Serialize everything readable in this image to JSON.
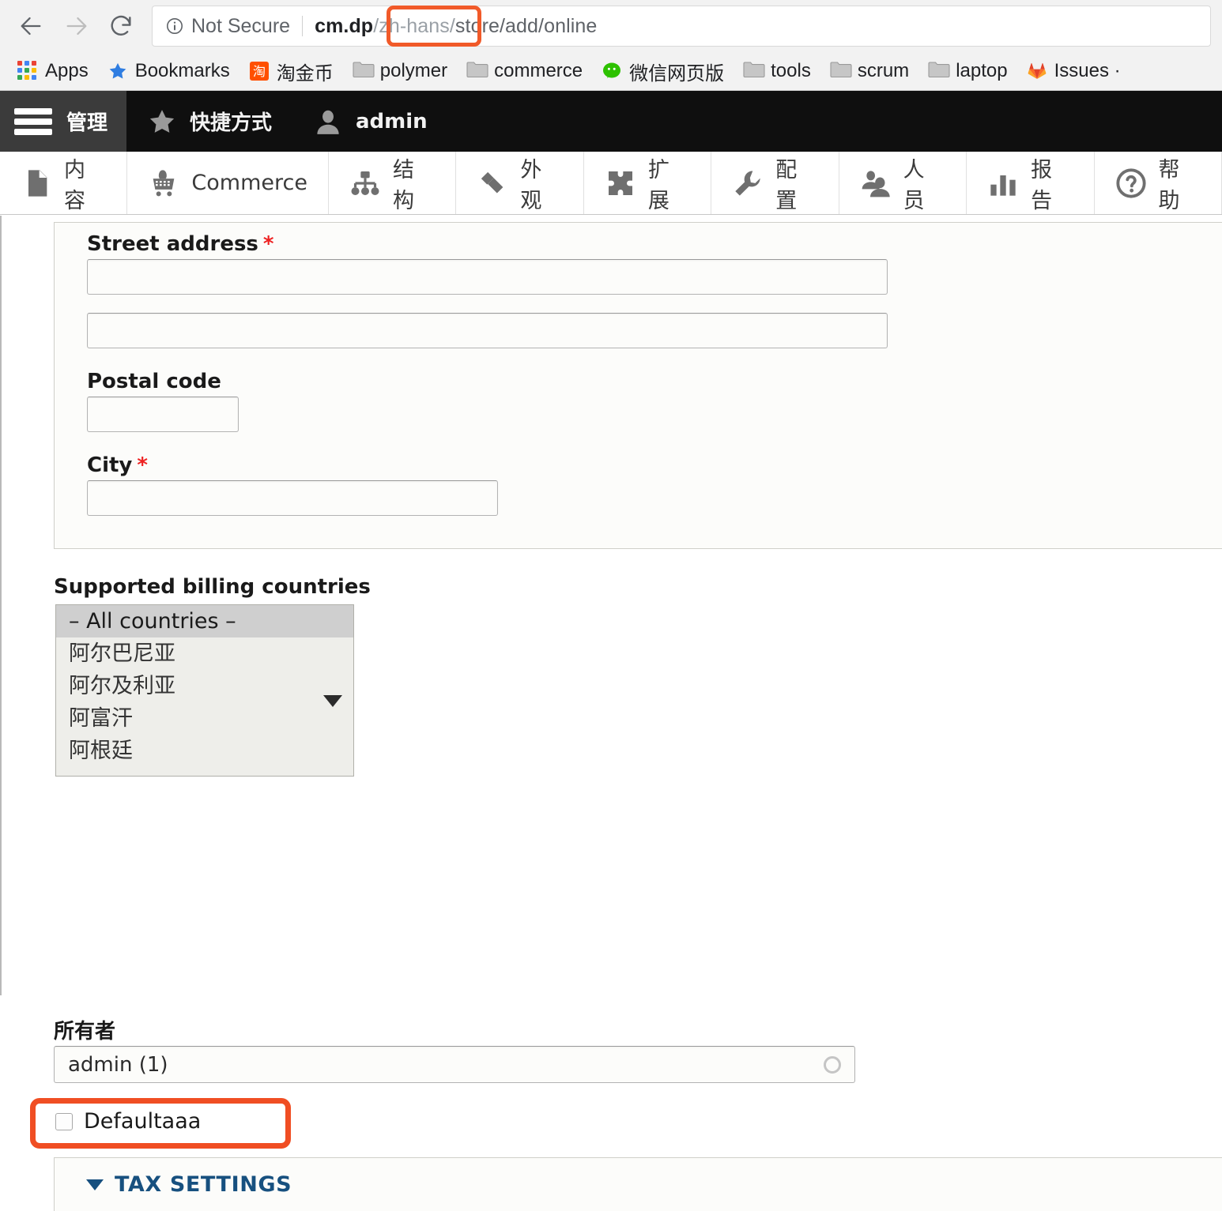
{
  "browser": {
    "nav": {
      "back_icon": "arrow-left-icon",
      "forward_icon": "arrow-right-icon",
      "reload_icon": "reload-icon"
    },
    "address_bar": {
      "security_icon": "info-circle-icon",
      "security_label": "Not Secure",
      "url_prefix": "cm.dp",
      "url_highlight": "/zh-hans/",
      "url_suffix": "store/add/online",
      "full_url": "cm.dp/zh-hans/store/add/online",
      "highlight_color": "#f15a29"
    },
    "bookmarks": [
      {
        "label": "Apps",
        "icon": "apps-grid-icon"
      },
      {
        "label": "Bookmarks",
        "icon": "star-icon"
      },
      {
        "label": "淘金币",
        "icon": "taobao-favicon"
      },
      {
        "label": "polymer",
        "icon": "folder-icon"
      },
      {
        "label": "commerce",
        "icon": "folder-icon"
      },
      {
        "label": "微信网页版",
        "icon": "wechat-icon"
      },
      {
        "label": "tools",
        "icon": "folder-icon"
      },
      {
        "label": "scrum",
        "icon": "folder-icon"
      },
      {
        "label": "laptop",
        "icon": "folder-icon"
      },
      {
        "label": "Issues ·",
        "icon": "gitlab-icon"
      }
    ]
  },
  "admin_toolbar": {
    "home": {
      "label": "管理",
      "icon": "hamburger-icon"
    },
    "tabs": [
      {
        "label": "快捷方式",
        "icon": "star-icon"
      },
      {
        "label": "admin",
        "icon": "user-icon"
      }
    ]
  },
  "admin_menu": {
    "items": [
      {
        "label": "内容",
        "icon": "document-icon"
      },
      {
        "label": "Commerce",
        "icon": "cart-icon"
      },
      {
        "label": "结构",
        "icon": "structure-icon"
      },
      {
        "label": "外观",
        "icon": "paintbrush-icon"
      },
      {
        "label": "扩展",
        "icon": "puzzle-icon"
      },
      {
        "label": "配置",
        "icon": "wrench-icon"
      },
      {
        "label": "人员",
        "icon": "people-icon"
      },
      {
        "label": "报告",
        "icon": "bar-chart-icon"
      },
      {
        "label": "帮助",
        "icon": "question-circle-icon"
      }
    ]
  },
  "form": {
    "address": {
      "street_label": "Street address",
      "street_required": "*",
      "street_value_1": "",
      "street_value_2": "",
      "postal_label": "Postal code",
      "postal_value": "",
      "city_label": "City",
      "city_required": "*",
      "city_value": ""
    },
    "billing_countries": {
      "label": "Supported billing countries",
      "options": [
        {
          "label": "– All countries –",
          "selected": true
        },
        {
          "label": "阿尔巴尼亚",
          "selected": false
        },
        {
          "label": "阿尔及利亚",
          "selected": false
        },
        {
          "label": "阿富汗",
          "selected": false
        },
        {
          "label": "阿根廷",
          "selected": false
        }
      ],
      "scroll_indicator": "triangle-down-icon"
    },
    "owner": {
      "label": "所有者",
      "value": "admin (1)",
      "throbber_icon": "circle-throbber-icon"
    },
    "default_checkbox": {
      "label": "Defaultaaa",
      "checked": false,
      "highlight_color": "#f04e23"
    },
    "tax_settings": {
      "summary": "TAX SETTINGS",
      "expanded": true,
      "toggle_icon": "triangle-down-icon",
      "accent_color": "#17507f"
    }
  }
}
